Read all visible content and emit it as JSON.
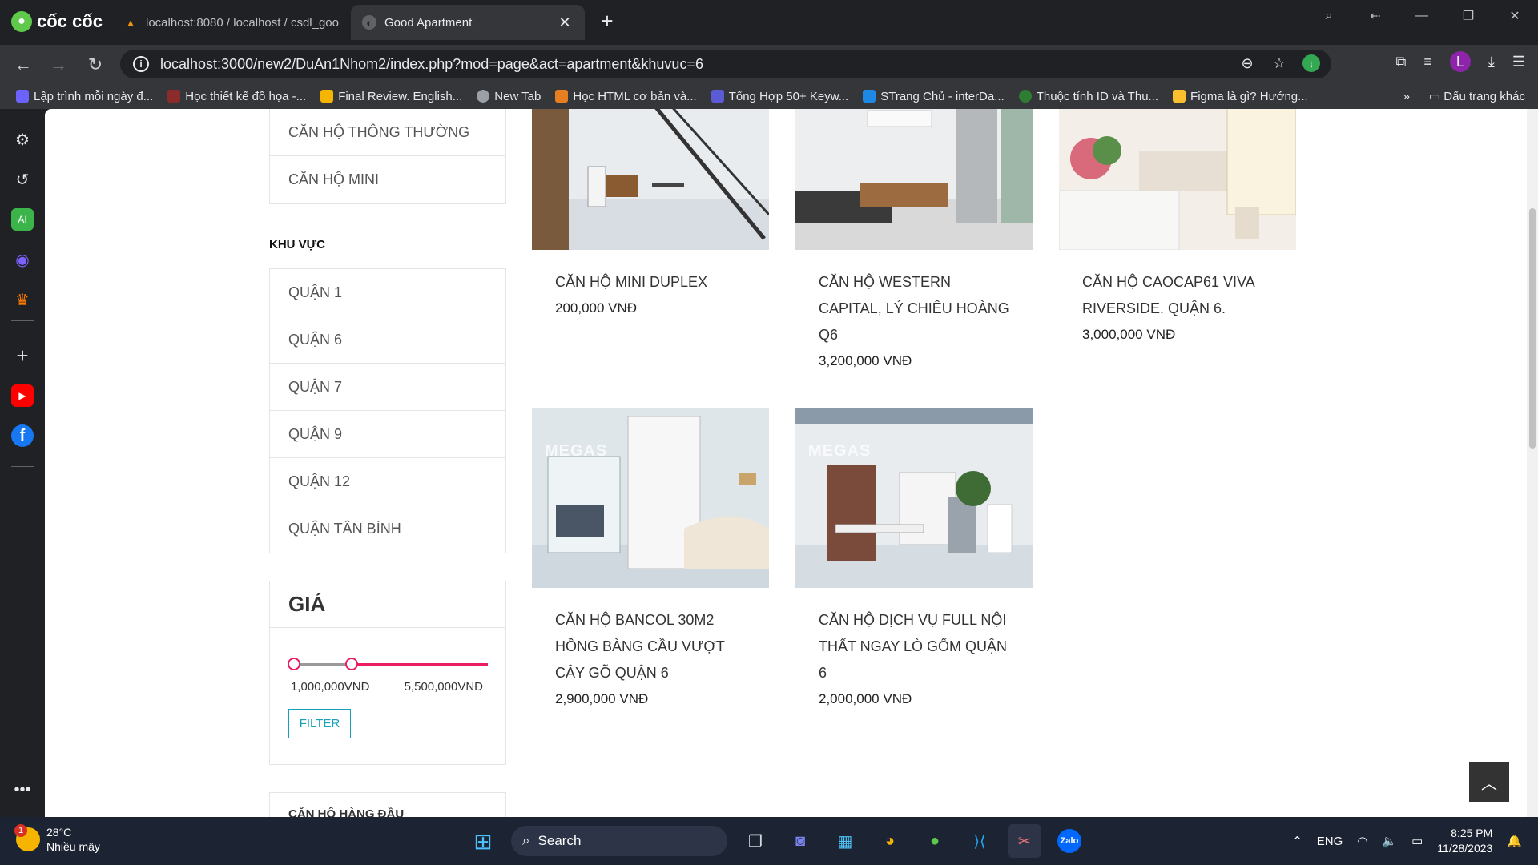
{
  "browser": {
    "brand": "cốc cốc",
    "tabs": [
      {
        "title": "localhost:8080 / localhost / csdl_goo",
        "active": false
      },
      {
        "title": "Good Apartment",
        "active": true
      }
    ],
    "url": "localhost:3000/new2/DuAn1Nhom2/index.php?mod=page&act=apartment&khuvuc=6",
    "bookmarks": [
      "Lập trình mỗi ngày đ...",
      "Học thiết kế đồ họa -...",
      "Final Review. English...",
      "New Tab",
      "Học HTML cơ bản và...",
      "Tổng Hợp 50+ Keyw...",
      "STrang Chủ - interDa...",
      "Thuộc tính ID và Thu...",
      "Figma là gì? Hướng..."
    ],
    "other_bookmarks": "Dấu trang khác",
    "profile_initial": "L"
  },
  "sidebar": {
    "categories": [
      "CĂN HỘ THÔNG THƯỜNG",
      "CĂN HỘ MINI"
    ],
    "area_title": "KHU VỰC",
    "areas": [
      "QUẬN 1",
      "QUẬN 6",
      "QUẬN 7",
      "QUẬN 9",
      "QUẬN 12",
      "QUẬN TÂN BÌNH"
    ],
    "price_title": "GIÁ",
    "price_min": "1,000,000VNĐ",
    "price_max": "5,500,000VNĐ",
    "filter_label": "FILTER",
    "next_section": "CĂN HỘ HÀNG ĐẦU"
  },
  "listings": [
    {
      "title": "CĂN HỘ MINI DUPLEX",
      "price": "200,000 VNĐ"
    },
    {
      "title": "CĂN HỘ WESTERN CAPITAL, LÝ CHIÊU HOÀNG Q6",
      "price": "3,200,000 VNĐ"
    },
    {
      "title": "CĂN HỘ CAOCAP61 VIVA RIVERSIDE. QUẬN 6.",
      "price": "3,000,000 VNĐ"
    },
    {
      "title": "CĂN HỘ BANCOL 30M2 HỒNG BÀNG CẦU VƯỢT CÂY GÕ QUẬN 6",
      "price": "2,900,000 VNĐ",
      "watermark": "MEGAS"
    },
    {
      "title": "CĂN HỘ DỊCH VỤ FULL NỘI THẤT NGAY LÒ GỐM QUẬN 6",
      "price": "2,000,000 VNĐ",
      "watermark": "MEGAS"
    }
  ],
  "taskbar": {
    "temp": "28°C",
    "weather": "Nhiều mây",
    "weather_badge": "1",
    "search": "Search",
    "lang": "ENG",
    "time": "8:25 PM",
    "date": "11/28/2023",
    "zalo": "Zalo"
  }
}
